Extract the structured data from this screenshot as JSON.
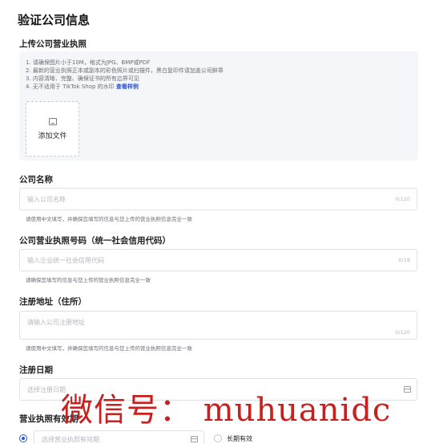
{
  "page_title": "验证公司信息",
  "upload": {
    "label": "上传公司营业执照",
    "hints": [
      "1. 请确保图片小于10M，格式为JPG、BMP或PDF",
      "2. 最新的营业执照正本或副本的彩色照片或扫描件，黑白复印件请加盖公司鲜章",
      "3. 内容清晰、完整、确保证书的所有边界可见",
      "4. 无不适用于 TikTok Shop 的水印"
    ],
    "hint_link": "查看样例",
    "add_file_label": "添加文件"
  },
  "company_name": {
    "label": "公司名称",
    "placeholder": "输入公司名称",
    "counter": "0/120",
    "help": "请使用中文填写，并确保您填写的信息与您上传的营业执照信息完全一致"
  },
  "license_number": {
    "label": "公司营业执照号码（统一社会信用代码）",
    "placeholder": "输入企业统一社会信用代码",
    "counter": "0/18",
    "help": "请确保您填写的信息与您上传的营业执照信息完全一致"
  },
  "address": {
    "label": "注册地址（住所）",
    "placeholder": "请输入公司注册地址",
    "counter": "0/120",
    "help": "请使用中文填写，并确保您填写的信息与您上传的营业执照信息完全一致"
  },
  "reg_date": {
    "label": "注册日期",
    "placeholder": "选择注册日期"
  },
  "validity": {
    "label": "营业执照有效期",
    "placeholder": "选择营业执照有效期",
    "long_term_label": "长期有效"
  },
  "watermark": "微信号： muhuanidc",
  "colors": {
    "accent": "#2a55d4",
    "link": "#2e53c9",
    "watermark": "#c81f1f"
  }
}
